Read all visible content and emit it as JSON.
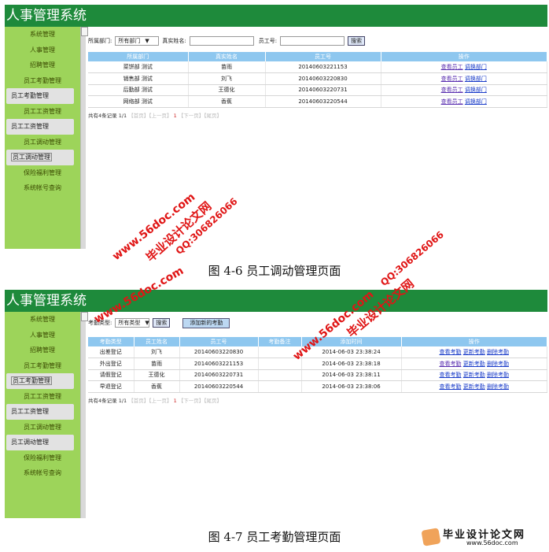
{
  "app_title": "人事管理系统",
  "menu": [
    "系统管理",
    "人事管理",
    "招聘管理",
    "员工考勤管理",
    "员工考勤管理",
    "员工工资管理",
    "员工工资管理",
    "员工调动管理",
    "员工调动管理",
    "保险福利管理",
    "系统帐号查询"
  ],
  "fig1": {
    "filter": {
      "dept_label": "所属部门:",
      "dept_value": "所有部门",
      "name_label": "真实姓名:",
      "id_label": "员工号:",
      "search": "搜索"
    },
    "columns": [
      "所属部门",
      "真实姓名",
      "员工号",
      "操作"
    ],
    "rows": [
      {
        "dept": "菜饼部 测试",
        "name": "苗雨",
        "id": "20140603221153"
      },
      {
        "dept": "销售部 测试",
        "name": "刘飞",
        "id": "20140603220830"
      },
      {
        "dept": "后勤部 测试",
        "name": "王德化",
        "id": "20140603220731"
      },
      {
        "dept": "网络部 测试",
        "name": "香蕉",
        "id": "20140603220544"
      }
    ],
    "action_view": "查看员工",
    "action_change": "调换部门",
    "pager": {
      "summary": "共有4条记录 1/1",
      "first": "【首页】",
      "prev": "【上一页】",
      "page": "1",
      "next": "【下一页】",
      "last": "【尾页】"
    },
    "caption": "图 4-6  员工调动管理页面"
  },
  "fig2": {
    "filter": {
      "type_label": "考勤类型:",
      "type_value": "所有类型",
      "search": "搜索",
      "add": "添加新的考勤"
    },
    "columns": [
      "考勤类型",
      "员工姓名",
      "员工号",
      "考勤备注",
      "添加时间",
      "操作"
    ],
    "rows": [
      {
        "type": "出差登记",
        "name": "刘飞",
        "id": "20140603220830",
        "note": "",
        "time": "2014-06-03 23:38:24"
      },
      {
        "type": "外出登记",
        "name": "苗雨",
        "id": "20140603221153",
        "note": "",
        "time": "2014-06-03 23:38:18"
      },
      {
        "type": "请假登记",
        "name": "王德化",
        "id": "20140603220731",
        "note": "",
        "time": "2014-06-03 23:38:11"
      },
      {
        "type": "早退登记",
        "name": "香蕉",
        "id": "20140603220544",
        "note": "",
        "time": "2014-06-03 23:38:06"
      }
    ],
    "action_view": "查看考勤",
    "action_update": "更新考勤",
    "action_delete": "删除考勤",
    "pager": {
      "summary": "共有4条记录 1/1",
      "first": "【首页】",
      "prev": "【上一页】",
      "page": "1",
      "next": "【下一页】",
      "last": "【尾页】"
    },
    "caption": "图 4-7  员工考勤管理页面"
  },
  "watermarks": {
    "site": "www.56doc.com",
    "qq": "QQ:306826066",
    "brand": "毕业设计论文网",
    "logo_title": "毕业设计论文网",
    "logo_url": "www.56doc.com"
  }
}
